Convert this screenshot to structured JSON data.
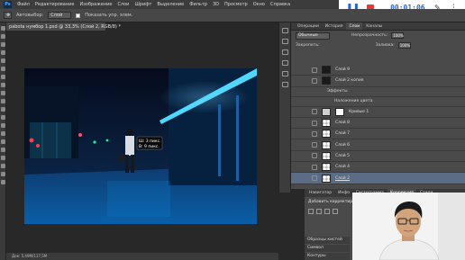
{
  "recording": {
    "timer": "00:01:06"
  },
  "menu": {
    "logo": "Ps",
    "items": [
      "Файл",
      "Редактирование",
      "Изображение",
      "Слои",
      "Шрифт",
      "Выделение",
      "Фильтр",
      "3D",
      "Просмотр",
      "Окно",
      "Справка"
    ]
  },
  "options": {
    "autoselect": "Автовыбор:",
    "autoselect_value": "Слой",
    "show_controls": "Показать упр. элем."
  },
  "document": {
    "tab": "pabota нумбор 1.psd @ 33,3% (Слой 2, RGB/8) *",
    "status": "Док: 5,49M/117,5M",
    "tooltip_line1": "Ш: 3 пикс.",
    "tooltip_line2": "В: 9 пикс."
  },
  "layers_panel": {
    "tabs": [
      "Операции",
      "История",
      "Слои",
      "Каналы"
    ],
    "active_tab": "Слои",
    "blend_mode": "Обычные",
    "opacity_label": "Непрозрачность:",
    "opacity_value": "100%",
    "lock_label": "Закрепить:",
    "fill_label": "Заливка:",
    "fill_value": "100%",
    "layers": [
      {
        "name": "Слой 9",
        "thumb": "dark"
      },
      {
        "name": "Слой 2 копия",
        "thumb": "dark"
      },
      {
        "name": "Эффекты",
        "thumb": "none"
      },
      {
        "name": "Наложение цвета",
        "thumb": "none"
      },
      {
        "name": "Кривые 1",
        "thumb": "white"
      },
      {
        "name": "Слой 8",
        "thumb": "checker"
      },
      {
        "name": "Слой 7",
        "thumb": "checker"
      },
      {
        "name": "Слой 6",
        "thumb": "checker"
      },
      {
        "name": "Слой 5",
        "thumb": "checker"
      },
      {
        "name": "Слой 4",
        "thumb": "checker"
      },
      {
        "name": "Слой 2",
        "thumb": "checker",
        "selected": true
      }
    ]
  },
  "lower": {
    "tabs": [
      "Навигатор",
      "Инфо",
      "Гистограмма",
      "Коррекция",
      "Стили"
    ],
    "active_tab": "Коррекция",
    "title": "Добавить корректировку",
    "mini_tabs": [
      "Образцы кистей",
      "Символ",
      "Контуры"
    ]
  },
  "colors": {
    "accent": "#5b6d86",
    "record_blue": "#2a62c8",
    "stop_red": "#e53935"
  }
}
